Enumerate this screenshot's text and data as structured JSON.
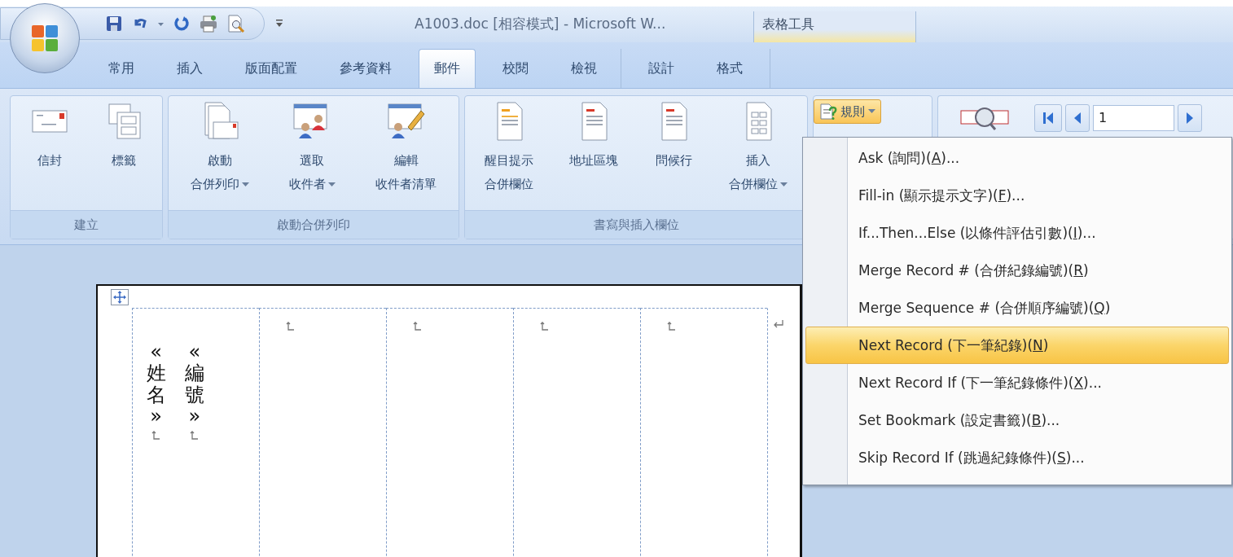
{
  "window": {
    "title": "A1003.doc [相容模式] - Microsoft W..."
  },
  "tabs": [
    {
      "label": "常用",
      "selected": false
    },
    {
      "label": "插入",
      "selected": false
    },
    {
      "label": "版面配置",
      "selected": false
    },
    {
      "label": "參考資料",
      "selected": false
    },
    {
      "label": "郵件",
      "selected": true
    },
    {
      "label": "校閱",
      "selected": false
    },
    {
      "label": "檢視",
      "selected": false
    }
  ],
  "table_tools": {
    "title": "表格工具",
    "tabs": [
      {
        "label": "設計",
        "selected": false
      },
      {
        "label": "格式",
        "selected": false
      }
    ]
  },
  "ribbon": {
    "groups": [
      {
        "kind": "large",
        "label": "建立",
        "buttons": [
          {
            "lines": [
              "信封"
            ],
            "dropdown": false
          },
          {
            "lines": [
              "標籤"
            ],
            "dropdown": false
          }
        ]
      },
      {
        "kind": "large",
        "label": "啟動合併列印",
        "buttons": [
          {
            "lines": [
              "啟動",
              "合併列印"
            ],
            "dropdown": true
          },
          {
            "lines": [
              "選取",
              "收件者"
            ],
            "dropdown": true
          },
          {
            "lines": [
              "編輯",
              "收件者清單"
            ],
            "dropdown": false
          }
        ]
      },
      {
        "kind": "large",
        "label": "書寫與插入欄位",
        "buttons": [
          {
            "lines": [
              "醒目提示",
              "合併欄位"
            ],
            "dropdown": false
          },
          {
            "lines": [
              "地址區塊"
            ],
            "dropdown": false
          },
          {
            "lines": [
              "問候行"
            ],
            "dropdown": false
          },
          {
            "lines": [
              "插入",
              "合併欄位"
            ],
            "dropdown": true
          }
        ]
      },
      {
        "kind": "rules",
        "button": {
          "label": "規則",
          "dropdown": true,
          "open": true
        }
      },
      {
        "kind": "preview",
        "record": "1"
      }
    ]
  },
  "menu": {
    "items": [
      {
        "before": "Ask (詢問)(",
        "key": "A",
        "after": ")...",
        "selected": false
      },
      {
        "before": "Fill-in (顯示提示文字)(",
        "key": "F",
        "after": ")...",
        "selected": false
      },
      {
        "before": "If...Then...Else (以條件評估引數)(",
        "key": "I",
        "after": ")...",
        "selected": false
      },
      {
        "before": "Merge Record # (合併紀錄編號)(",
        "key": "R",
        "after": ")",
        "selected": false
      },
      {
        "before": "Merge Sequence # (合併順序編號)(",
        "key": "Q",
        "after": ")",
        "selected": false
      },
      {
        "before": "Next Record (下一筆紀錄)(",
        "key": "N",
        "after": ")",
        "selected": true
      },
      {
        "before": "Next Record If (下一筆紀錄條件)(",
        "key": "X",
        "after": ")...",
        "selected": false
      },
      {
        "before": "Set Bookmark (設定書籤)(",
        "key": "B",
        "after": ")...",
        "selected": false
      },
      {
        "before": "Skip Record If (跳過紀錄條件)(",
        "key": "S",
        "after": ")...",
        "selected": false
      }
    ]
  },
  "document": {
    "cells": [
      {
        "kind": "fields",
        "fields": [
          "«姓名»",
          "«編號»"
        ]
      },
      {
        "kind": "empty"
      },
      {
        "kind": "empty"
      },
      {
        "kind": "empty"
      },
      {
        "kind": "empty"
      }
    ]
  }
}
